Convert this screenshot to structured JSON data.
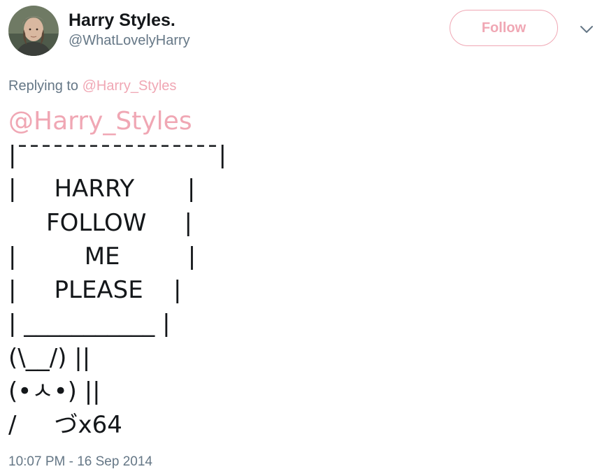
{
  "user": {
    "display_name": "Harry Styles.",
    "handle": "@WhatLovelyHarry",
    "avatar_icon": "profile-photo"
  },
  "header": {
    "follow_label": "Follow",
    "menu_icon": "chevron-down-icon"
  },
  "reply": {
    "prefix": "Replying to",
    "mention": "@Harry_Styles"
  },
  "tweet": {
    "mention": "@Harry_Styles",
    "lines": [
      "|¯¯¯¯¯¯¯¯¯¯¯¯¯¯¯¯¯|",
      "|     HARRY       |",
      "     FOLLOW     |",
      "|         ME         |",
      "|     PLEASE    |",
      "| ___________ |",
      "(\\__/) ||",
      "(•ㅅ•) ||",
      "/     づx64"
    ]
  },
  "timestamp": "10:07 PM - 16 Sep 2014",
  "colors": {
    "accent": "#f0a7b4",
    "text": "#14171a",
    "secondary": "#657786"
  }
}
